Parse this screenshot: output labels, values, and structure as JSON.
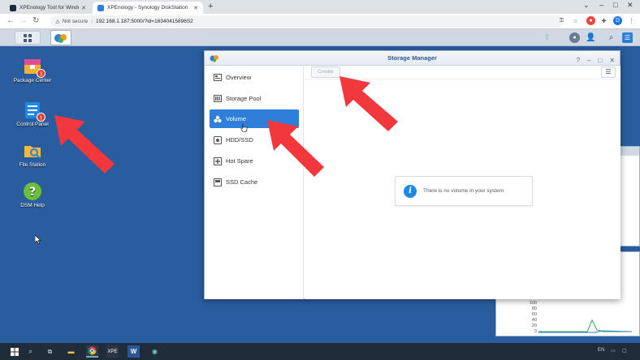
{
  "browser": {
    "tabs": [
      {
        "label": "XPEnology Tool for Windows x64",
        "active": false
      },
      {
        "label": "XPEnology - Synology DiskStation",
        "active": true
      }
    ],
    "new_tab": "+",
    "security": "Not secure",
    "url": "192.168.1.187:5000/?id=16340415896S2",
    "profile_initial": "D"
  },
  "desktop": {
    "icons": [
      {
        "label": "Package Center",
        "badge": "3"
      },
      {
        "label": "Control Panel",
        "badge": "1"
      },
      {
        "label": "File Station",
        "badge": ""
      },
      {
        "label": "DSM Help",
        "badge": ""
      }
    ]
  },
  "window": {
    "title": "Storage Manager",
    "controls": [
      "?",
      "–",
      "□",
      "✕"
    ],
    "sidebar": [
      {
        "label": "Overview",
        "icon": "overview-icon",
        "active": false
      },
      {
        "label": "Storage Pool",
        "icon": "storage-pool-icon",
        "active": false
      },
      {
        "label": "Volume",
        "icon": "volume-icon",
        "active": true
      },
      {
        "label": "HDD/SSD",
        "icon": "hdd-icon",
        "active": false
      },
      {
        "label": "Hot Spare",
        "icon": "hot-spare-icon",
        "active": false
      },
      {
        "label": "SSD Cache",
        "icon": "ssd-cache-icon",
        "active": false
      }
    ],
    "toolbar": {
      "create_label": "Create"
    },
    "empty_message": "There is no volume in your system"
  },
  "resource_monitor": {
    "y_ticks": [
      "100",
      "80",
      "60",
      "40",
      "20",
      "0"
    ]
  },
  "taskbar": {
    "apps": [
      "XPE",
      "W"
    ],
    "lang": "EN"
  },
  "colors": {
    "desktop": "#2a5d9f",
    "accent": "#2f7ed8",
    "arrow": "#f2383d"
  }
}
